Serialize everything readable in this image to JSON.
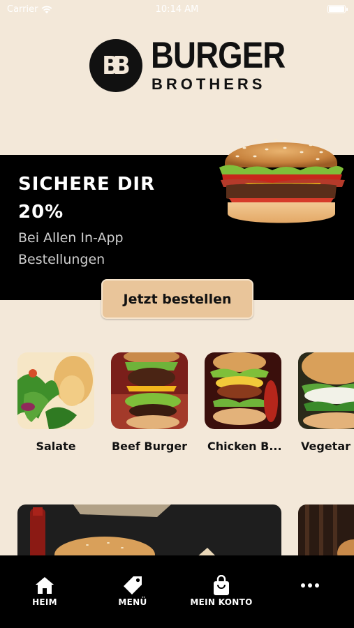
{
  "status_bar": {
    "carrier": "Carrier",
    "time": "10:14 AM"
  },
  "brand": {
    "mark": "BB",
    "word1": "BURGER",
    "word2": "BROTHERS"
  },
  "promo": {
    "headline_line1": "SICHERE DIR",
    "headline_line2": "20%",
    "sub_line1": "Bei Allen In-App",
    "sub_line2": "Bestellungen",
    "cta_label": "Jetzt bestellen"
  },
  "categories": [
    {
      "label": "Salate",
      "icon": "salad-image"
    },
    {
      "label": "Beef Burger",
      "icon": "beef-burger-image"
    },
    {
      "label": "Chicken B...",
      "icon": "chicken-burger-image"
    },
    {
      "label": "Vegetar",
      "icon": "veggie-burger-image"
    }
  ],
  "tab_bar": {
    "items": [
      {
        "label": "HEIM",
        "icon": "home-icon"
      },
      {
        "label": "MENÜ",
        "icon": "tag-icon"
      },
      {
        "label": "MEIN KONTO",
        "icon": "shopping-bag-icon"
      },
      {
        "label": "",
        "icon": "more-icon"
      }
    ]
  },
  "colors": {
    "background": "#f3e8d9",
    "accent": "#e9c59a",
    "dark": "#000000"
  }
}
